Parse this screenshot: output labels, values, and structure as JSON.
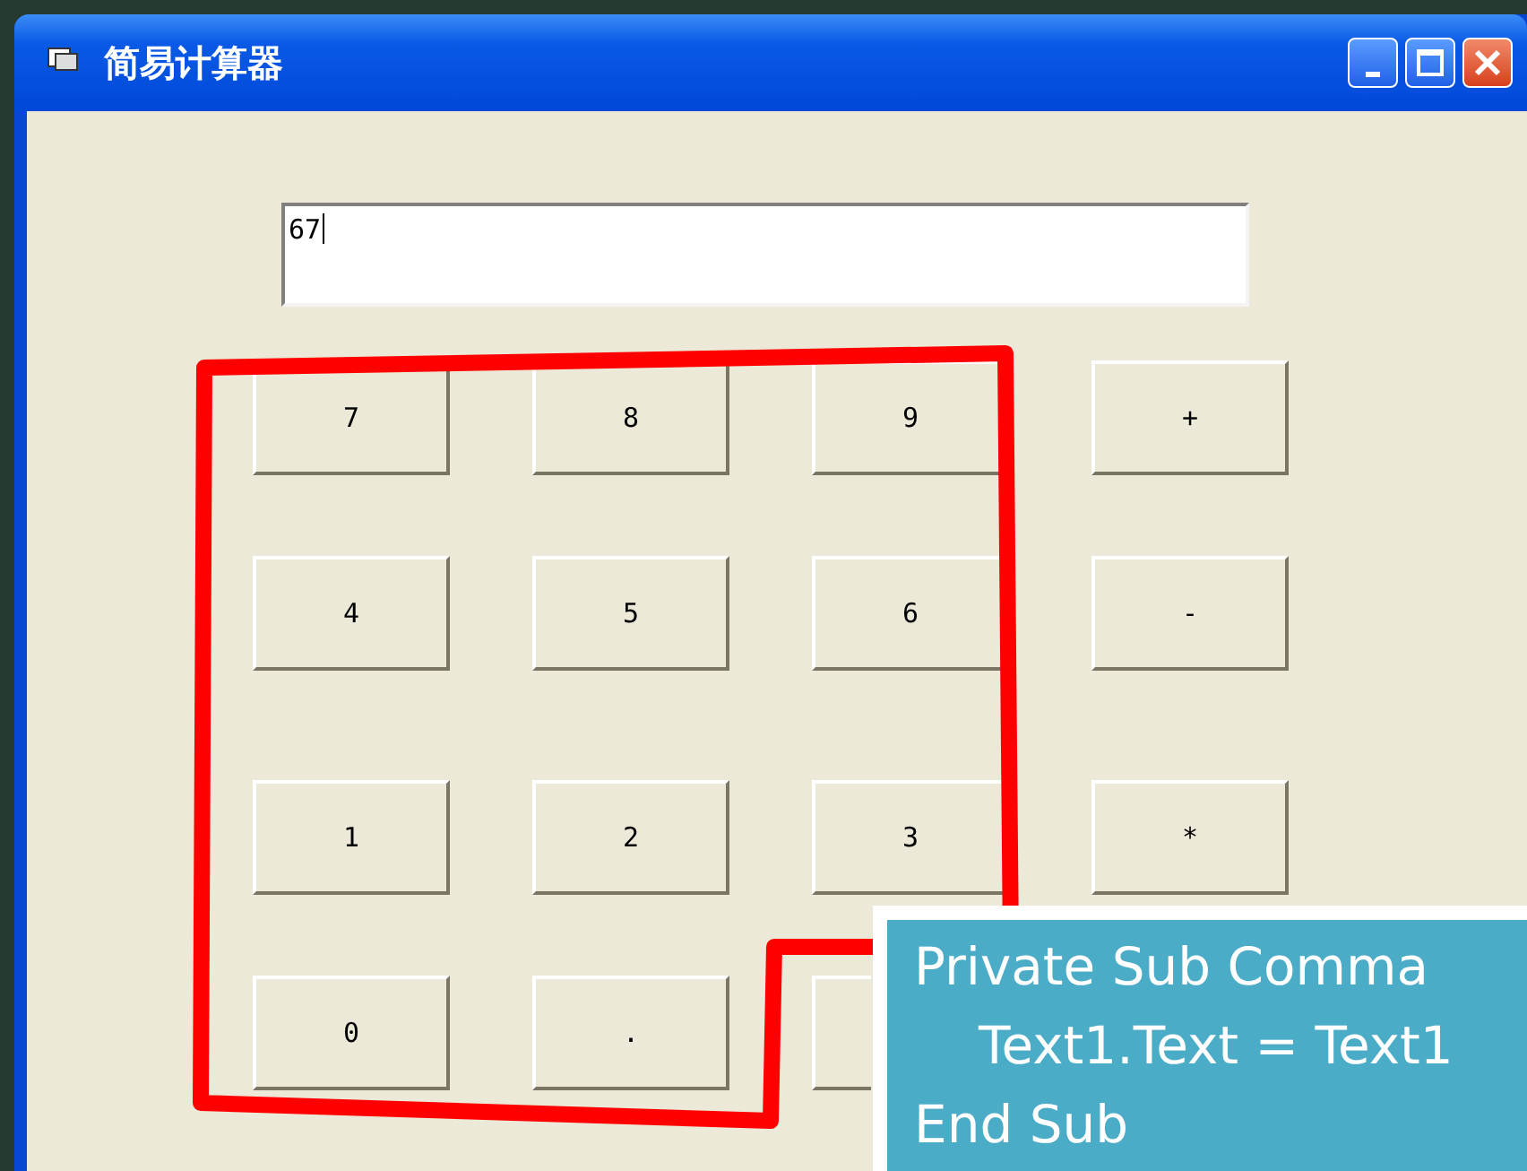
{
  "window": {
    "title": "简易计算器"
  },
  "display": {
    "value": "67"
  },
  "keypad": [
    [
      {
        "kind": "key",
        "label": "7"
      },
      {
        "kind": "key",
        "label": "8"
      },
      {
        "kind": "key",
        "label": "9"
      },
      {
        "kind": "key",
        "label": "+"
      }
    ],
    [
      {
        "kind": "key",
        "label": "4"
      },
      {
        "kind": "key",
        "label": "5"
      },
      {
        "kind": "key",
        "label": "6"
      },
      {
        "kind": "key",
        "label": "-"
      }
    ],
    [
      {
        "kind": "key",
        "label": "1"
      },
      {
        "kind": "key",
        "label": "2"
      },
      {
        "kind": "key",
        "label": "3"
      },
      {
        "kind": "key",
        "label": "*"
      }
    ],
    [
      {
        "kind": "key",
        "label": "0"
      },
      {
        "kind": "key",
        "label": "."
      },
      {
        "kind": "covered"
      }
    ]
  ],
  "callout": {
    "lines": [
      {
        "text": "Private Sub Comma",
        "indent": false
      },
      {
        "text": "Text1.Text = Text1",
        "indent": true
      },
      {
        "text": "End Sub",
        "indent": false
      }
    ]
  }
}
